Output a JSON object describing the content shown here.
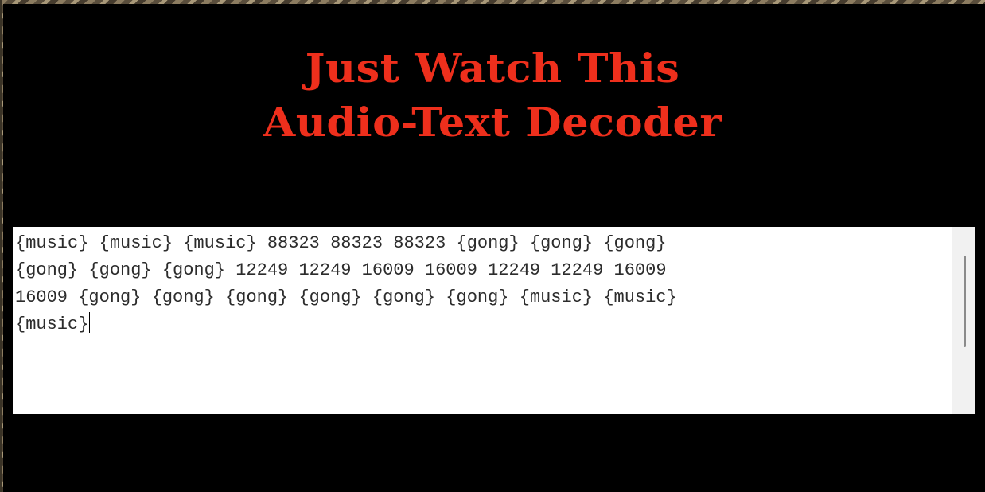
{
  "header": {
    "title_line1": "Just Watch This",
    "title_line2": "Audio-Text Decoder"
  },
  "decoder": {
    "lines": [
      "{music} {music} {music} 88323 88323 88323 {gong} {gong} {gong}",
      "{gong} {gong} {gong} 12249 12249 16009 16009 12249 12249 16009",
      "16009 {gong} {gong} {gong} {gong} {gong} {gong} {music} {music}",
      "{music}"
    ]
  },
  "colors": {
    "title": "#ee2f1c",
    "panel_background": "#000000",
    "text_area_background": "#ffffff"
  }
}
